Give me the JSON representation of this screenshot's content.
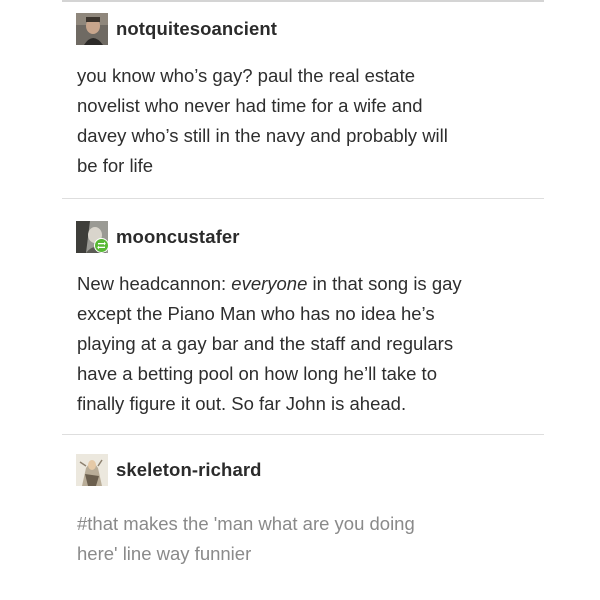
{
  "posts": [
    {
      "username": "notquitesoancient",
      "avatar_icon": "user-avatar-icon",
      "body_lines": [
        "you know who’s gay? paul the real estate",
        "novelist who never had time for a wife and",
        "davey who’s still in the navy and probably will",
        "be for life"
      ]
    },
    {
      "username": "mooncustafer",
      "avatar_icon": "user-avatar-icon",
      "reblog_badge_icon": "reblog-icon",
      "body_lines": [
        {
          "pre": "New headcannon: ",
          "em": "everyone",
          "post": " in that song is gay"
        },
        "except the Piano Man who has no idea he’s",
        "playing at a gay bar and the staff and regulars",
        "have a betting pool on how long he’ll take to",
        "finally figure it out. So far John is ahead."
      ]
    },
    {
      "username": "skeleton-richard",
      "avatar_icon": "user-avatar-icon",
      "tag_lines": [
        "#that makes the 'man what are you doing",
        "here' line way funnier"
      ]
    }
  ],
  "colors": {
    "text": "#2e2e2e",
    "username": "#2b2b2b",
    "tags": "#8a8a8a",
    "divider": "#dedede",
    "reblog_badge": "#58b935"
  }
}
